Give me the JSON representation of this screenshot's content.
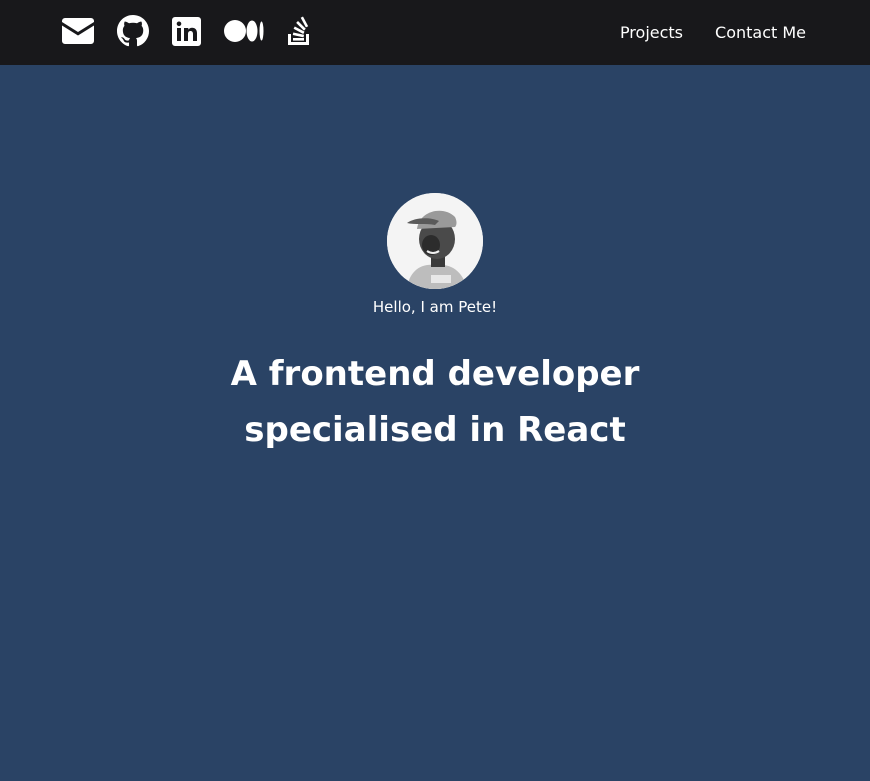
{
  "header": {
    "social_icons": [
      "envelope-icon",
      "github-icon",
      "linkedin-icon",
      "medium-icon",
      "stackoverflow-icon"
    ],
    "nav": [
      {
        "label": "Projects"
      },
      {
        "label": "Contact Me"
      }
    ]
  },
  "hero": {
    "greeting": "Hello, I am Pete!",
    "headline_line1": "A frontend developer",
    "headline_line2": "specialised in React"
  },
  "colors": {
    "header_bg": "#18181b",
    "page_bg": "#2a4365",
    "text": "#ffffff"
  }
}
